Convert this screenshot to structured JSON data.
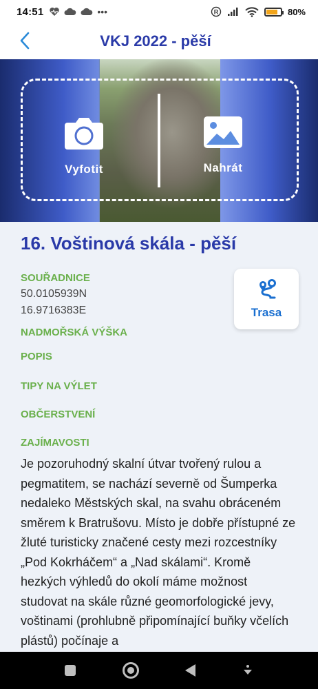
{
  "status": {
    "time": "14:51",
    "left_icons": [
      "heart-rate-icon",
      "cloud-icon",
      "cloud-icon",
      "more-dots-icon"
    ],
    "right_icons": [
      "registered-icon",
      "signal-icon",
      "wifi-icon",
      "battery-icon"
    ],
    "battery_percent": "80%",
    "battery_level": 0.8
  },
  "header": {
    "title": "VKJ 2022 - pěší",
    "back_icon": "chevron-left-icon"
  },
  "hero": {
    "photo_label": "Vyfotit",
    "upload_label": "Nahrát",
    "photo_icon": "camera-icon",
    "upload_icon": "image-icon"
  },
  "place": {
    "title": "16. Voštinová skála - pěší",
    "coords_label": "SOUŘADNICE",
    "lat": "50.0105939N",
    "lon": "16.9716383E",
    "altitude_label": "NADMOŘSKÁ VÝŠKA",
    "description_label": "POPIS",
    "tips_label": "TIPY NA VÝLET",
    "refreshments_label": "OBČERSTVENÍ",
    "interesting_label": "ZAJÍMAVOSTI",
    "interesting_text": "Je pozoruhodný skalní útvar tvořený rulou a pegmatitem, se nachází severně od Šumperka nedaleko Městských skal, na svahu obráceném směrem k Bratrušovu. Místo je dobře přístupné ze žluté turisticky značené cesty mezi rozcestníky „Pod Kokrháčem“ a „Nad skálami“. Kromě hezkých výhledů do okolí máme možnost studovat na skále různé geomorfologické jevy, voštinami (prohlubně připomínající buňky včelích plástů) počínaje a"
  },
  "route": {
    "label": "Trasa",
    "icon": "route-icon"
  },
  "colors": {
    "primary": "#2a3aa8",
    "accent_green": "#6ab04c",
    "route_blue": "#1a6fd0",
    "background": "#eef2f8"
  },
  "navbar": {
    "icons": [
      "recents-square-icon",
      "home-circle-icon",
      "back-triangle-icon",
      "more-icon"
    ]
  }
}
